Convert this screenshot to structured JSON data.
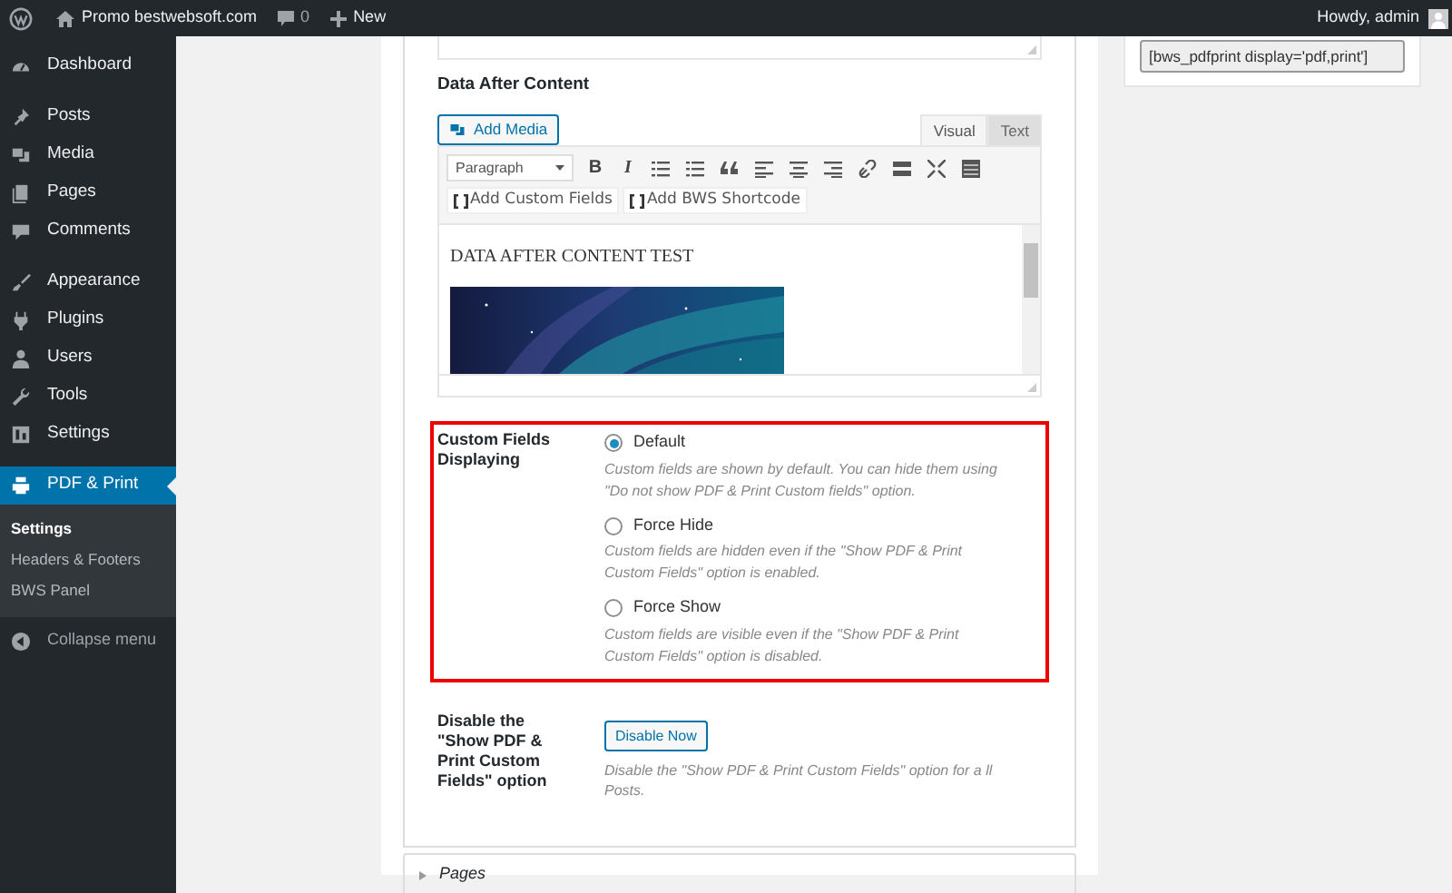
{
  "admin_bar": {
    "site_name": "Promo bestwebsoft.com",
    "comments_count": "0",
    "new_label": "New",
    "greeting": "Howdy, admin"
  },
  "sidebar": {
    "items": [
      {
        "label": "Dashboard",
        "selected": false
      },
      {
        "label": "Posts",
        "selected": false
      },
      {
        "label": "Media",
        "selected": false
      },
      {
        "label": "Pages",
        "selected": false
      },
      {
        "label": "Comments",
        "selected": false
      },
      {
        "label": "Appearance",
        "selected": false
      },
      {
        "label": "Plugins",
        "selected": false
      },
      {
        "label": "Users",
        "selected": false
      },
      {
        "label": "Tools",
        "selected": false
      },
      {
        "label": "Settings",
        "selected": false
      },
      {
        "label": "PDF & Print",
        "selected": true
      }
    ],
    "submenu": [
      {
        "label": "Settings",
        "selected": true
      },
      {
        "label": "Headers & Footers",
        "selected": false
      },
      {
        "label": "BWS Panel",
        "selected": false
      }
    ],
    "collapse_label": "Collapse menu"
  },
  "shortcode_box": {
    "value": "[bws_pdfprint display='pdf,print']"
  },
  "data_after_content": {
    "title": "Data After Content",
    "add_media": "Add Media",
    "tabs": [
      {
        "label": "Visual",
        "selected": true
      },
      {
        "label": "Text",
        "selected": false
      }
    ],
    "format_select": "Paragraph",
    "bold_glyph": "B",
    "italic_glyph": "I",
    "buttons": [
      "Add Custom Fields",
      "Add BWS Shortcode"
    ],
    "content_text": "DATA AFTER CONTENT TEST"
  },
  "custom_fields_displaying": {
    "label": "Custom Fields Displaying",
    "options": [
      {
        "label": "Default",
        "selected": true,
        "description": "Custom fields are shown by default. You can hide them using \"Do not show PDF & Print Custom fields\" option."
      },
      {
        "label": "Force Hide",
        "selected": false,
        "description": "Custom fields are hidden even if the \"Show PDF & Print Custom Fields\" option is enabled."
      },
      {
        "label": "Force Show",
        "selected": false,
        "description": "Custom fields are visible even if the \"Show PDF & Print Custom Fields\" option is disabled."
      }
    ]
  },
  "disable_option": {
    "label": "Disable the \"Show PDF & Print Custom Fields\" option",
    "button": "Disable Now",
    "description": "Disable the \"Show PDF & Print Custom Fields\" option for a ll Posts."
  },
  "pages_section": {
    "title": "Pages",
    "expanded": false
  }
}
